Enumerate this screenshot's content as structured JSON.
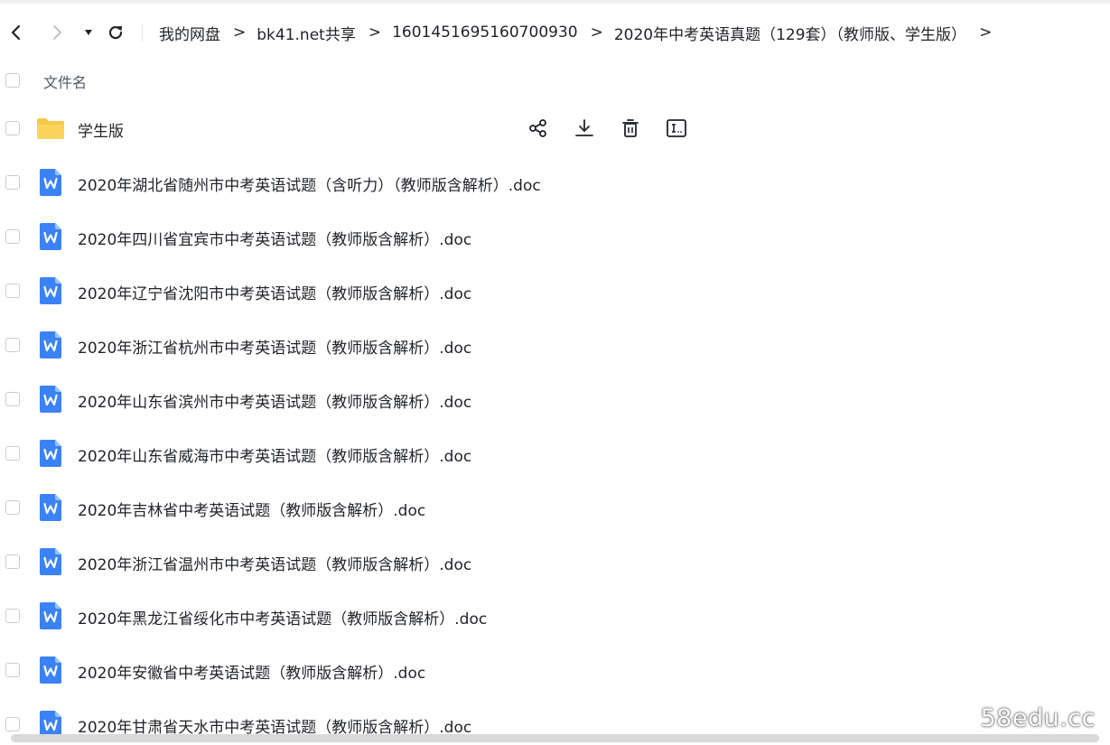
{
  "toolbar": {
    "back_icon": "chevron-left-icon",
    "forward_icon": "chevron-right-icon",
    "history_dropdown_icon": "caret-down-icon",
    "refresh_icon": "refresh-icon",
    "breadcrumb": [
      "我的网盘",
      "bk41.net共享",
      "1601451695160700930",
      "2020年中考英语真题（129套）（教师版、学生版）"
    ],
    "separator": ">",
    "trailing_separator": ">"
  },
  "list": {
    "header_label": "文件名",
    "rows": [
      {
        "name": "学生版",
        "type": "folder",
        "icon": "folder-icon",
        "actions": [
          "share-icon",
          "download-icon",
          "delete-icon",
          "rename-icon"
        ]
      },
      {
        "name": "2020年湖北省随州市中考英语试题（含听力）（教师版含解析）.doc",
        "type": "doc",
        "icon": "word-doc-icon"
      },
      {
        "name": "2020年四川省宜宾市中考英语试题（教师版含解析）.doc",
        "type": "doc",
        "icon": "word-doc-icon"
      },
      {
        "name": "2020年辽宁省沈阳市中考英语试题（教师版含解析）.doc",
        "type": "doc",
        "icon": "word-doc-icon"
      },
      {
        "name": "2020年浙江省杭州市中考英语试题（教师版含解析）.doc",
        "type": "doc",
        "icon": "word-doc-icon"
      },
      {
        "name": "2020年山东省滨州市中考英语试题（教师版含解析）.doc",
        "type": "doc",
        "icon": "word-doc-icon"
      },
      {
        "name": "2020年山东省威海市中考英语试题（教师版含解析）.doc",
        "type": "doc",
        "icon": "word-doc-icon"
      },
      {
        "name": "2020年吉林省中考英语试题（教师版含解析）.doc",
        "type": "doc",
        "icon": "word-doc-icon"
      },
      {
        "name": "2020年浙江省温州市中考英语试题（教师版含解析）.doc",
        "type": "doc",
        "icon": "word-doc-icon"
      },
      {
        "name": "2020年黑龙江省绥化市中考英语试题（教师版含解析）.doc",
        "type": "doc",
        "icon": "word-doc-icon"
      },
      {
        "name": "2020年安徽省中考英语试题（教师版含解析）.doc",
        "type": "doc",
        "icon": "word-doc-icon"
      },
      {
        "name": "2020年甘肃省天水市中考英语试题（教师版含解析）.doc",
        "type": "doc",
        "icon": "word-doc-icon"
      }
    ]
  },
  "watermark": "58edu.cc",
  "colors": {
    "folder": "#f7c84a",
    "doc": "#3b82f6",
    "text": "#1f2329",
    "muted": "#4e5969"
  }
}
